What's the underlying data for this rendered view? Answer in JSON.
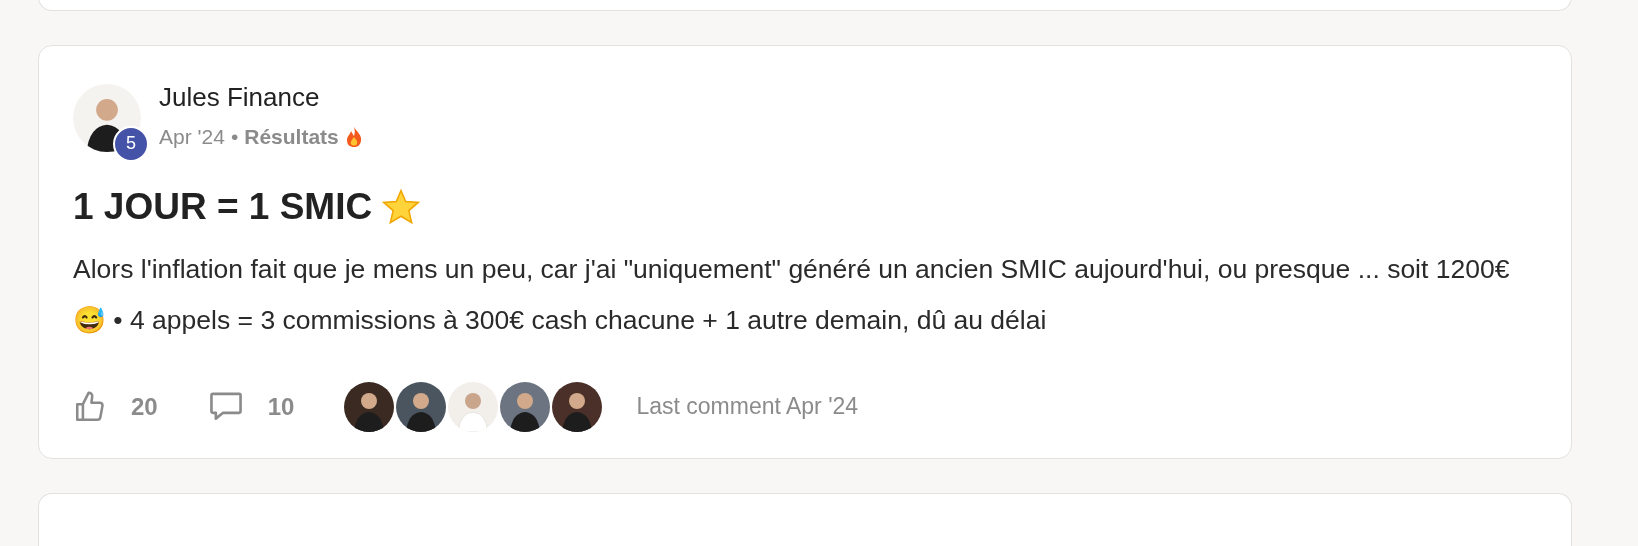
{
  "post": {
    "author": "Jules Finance",
    "level_badge": "5",
    "date": "Apr '24",
    "separator": "•",
    "category": "Résultats",
    "title": "1 JOUR = 1 SMIC",
    "body": "Alors l'inflation fait que je mens un peu, car j'ai \"uniquement\" généré un ancien SMIC aujourd'hui, ou presque ... soit 1200€ 😅 • 4 appels = 3 commissions à 300€ cash chacune + 1 autre demain, dû au délai",
    "likes": "20",
    "comments": "10",
    "commenters": [
      {
        "color": "#3a2a22"
      },
      {
        "color": "#4a5560"
      },
      {
        "color": "#f2eeea"
      },
      {
        "color": "#6b7480"
      },
      {
        "color": "#4a3028"
      }
    ],
    "last_comment": "Last comment Apr '24"
  }
}
